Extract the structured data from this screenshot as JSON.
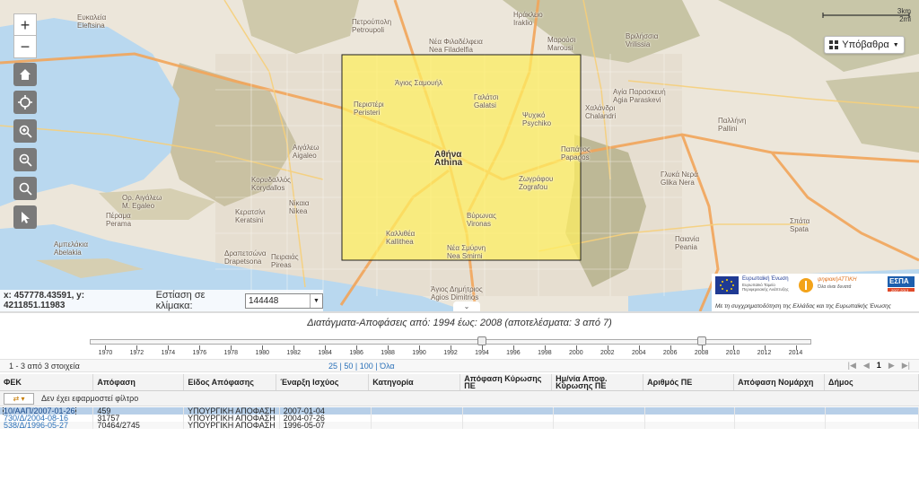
{
  "map": {
    "places": [
      {
        "name": "Ευκαλεία\nEleftsina",
        "cls": ""
      },
      {
        "name": "Πετρούπολη\nPetroupoli",
        "cls": ""
      },
      {
        "name": "Νέα Φιλαδέλφεια\nNea Filadelfia",
        "cls": ""
      },
      {
        "name": "Μαρούσι\nMarousi",
        "cls": ""
      },
      {
        "name": "Ηράκλειο\nIraklio",
        "cls": ""
      },
      {
        "name": "Βριλήσσια\nVrilissia",
        "cls": ""
      },
      {
        "name": "Περιστέρι\nPeristeri",
        "cls": ""
      },
      {
        "name": "Χαλάνδρι\nChalandri",
        "cls": ""
      },
      {
        "name": "Αγία Παρασκευή\nAgia Paraskevi",
        "cls": ""
      },
      {
        "name": "Άγιος Σαμουήλ",
        "cls": ""
      },
      {
        "name": "Αιγάλεω\nAigaleo",
        "cls": ""
      },
      {
        "name": "Αθήνα\nAthina",
        "cls": "strong"
      },
      {
        "name": "Παπάγος\nPapagos",
        "cls": ""
      },
      {
        "name": "Ζωγράφου\nZografou",
        "cls": ""
      },
      {
        "name": "Ορ. Αιγάλεω\nM. Egaleo",
        "cls": ""
      },
      {
        "name": "Κορυδαλλός\nKorydallos",
        "cls": ""
      },
      {
        "name": "Νίκαια\nNikea",
        "cls": ""
      },
      {
        "name": "Καλλιθέα\nKallithea",
        "cls": ""
      },
      {
        "name": "Βύρωνας\nVironas",
        "cls": ""
      },
      {
        "name": "Γλυκά Νερά\nGlika Nera",
        "cls": ""
      },
      {
        "name": "Κερατσίνι\nKeratsini",
        "cls": ""
      },
      {
        "name": "Πέραμα\nPerama",
        "cls": ""
      },
      {
        "name": "Δραπετσώνα\nDrapetsona",
        "cls": ""
      },
      {
        "name": "Πειραιάς\nPireas",
        "cls": ""
      },
      {
        "name": "Νέα Σμύρνη\nNea Smirni",
        "cls": ""
      },
      {
        "name": "Αμπελάκια\nAbelakia",
        "cls": ""
      },
      {
        "name": "Παλλήνη\nPallini",
        "cls": ""
      },
      {
        "name": "Παιανία\nPeania",
        "cls": ""
      },
      {
        "name": "Σπάτα\nSpata",
        "cls": ""
      },
      {
        "name": "Άγιος Δημήτριος\nAgios Dimitrios",
        "cls": ""
      },
      {
        "name": "Ψυχικό\nPsychiko",
        "cls": ""
      },
      {
        "name": "Γαλάτσι\nGalatsi",
        "cls": ""
      }
    ],
    "scale_label": "3km",
    "scale_label2": "2mi",
    "basemap_label": "Υπόβαθρα",
    "coords_text": "x: 457778.43591, y: 4211851.11983",
    "scale_focus_label": "Εστίαση σε κλίμακα:",
    "scale_value": "144448",
    "logos_caption": "Με τη συγχρηματοδότηση της Ελλάδας και της Ευρωπαϊκής Ένωσης",
    "logo_eu": "Ευρωπαϊκή Ένωση",
    "logo_eu_sub": "Ευρωπαϊκό Ταμείο Περιφερειακής Ανάπτυξης",
    "logo_ict": "ψηφιακήΑΤΤΙΚΗ",
    "logo_ict_sub": "Όλα είναι δυνατά",
    "logo_espa": "ΕΣΠΑ",
    "logo_espa_sub": "2007-2013"
  },
  "timeline": {
    "title": "Διατάγματα-Αποφάσεις από: 1994 έως: 2008 (αποτελέσματα: 3 από 7)",
    "years": [
      "1970",
      "1972",
      "1974",
      "1976",
      "1978",
      "1980",
      "1982",
      "1984",
      "1986",
      "1988",
      "1990",
      "1992",
      "1994",
      "1996",
      "1998",
      "2000",
      "2002",
      "2004",
      "2006",
      "2008",
      "2010",
      "2012",
      "2014"
    ],
    "range_from": 1994,
    "range_to": 2008
  },
  "pager": {
    "count_text": "1 - 3 από 3 στοιχεία",
    "size_25": "25",
    "size_50": "50",
    "size_100": "100",
    "size_all": "Όλα",
    "first": "|◀",
    "prev": "◀",
    "page": "1",
    "next": "▶",
    "last": "▶|"
  },
  "table": {
    "headers": [
      "ΦΕΚ",
      "Απόφαση",
      "Είδος Απόφασης",
      "Έναρξη Ισχύος",
      "Κατηγορία",
      "Απόφαση Κύρωσης ΠΕ",
      "Ημ/νία Αποφ. Κύρωσης ΠΕ",
      "Αριθμός ΠΕ",
      "Απόφαση Νομάρχη",
      "Δήμος"
    ],
    "filter_text": "Δεν έχει εφαρμοστεί φίλτρο",
    "rows": [
      {
        "fek": "10/ΑΑΠ/2007-01-26",
        "apofasi": "459",
        "eidos": "ΥΠΟΥΡΓΙΚΗ ΑΠΟΦΑΣΗ",
        "enarxi": "2007-01-04"
      },
      {
        "fek": "730/Δ/2004-08-16",
        "apofasi": "31757",
        "eidos": "ΥΠΟΥΡΓΙΚΗ ΑΠΟΦΑΣΗ",
        "enarxi": "2004-07-26"
      },
      {
        "fek": "538/Δ/1996-05-27",
        "apofasi": "70464/2745",
        "eidos": "ΥΠΟΥΡΓΙΚΗ ΑΠΟΦΑΣΗ",
        "enarxi": "1996-05-07"
      }
    ]
  },
  "colors": {
    "selection_box": "#fff060",
    "sea": "#b9d8ef",
    "link": "#2a70b8",
    "selected_row": "#b7cfe8"
  }
}
